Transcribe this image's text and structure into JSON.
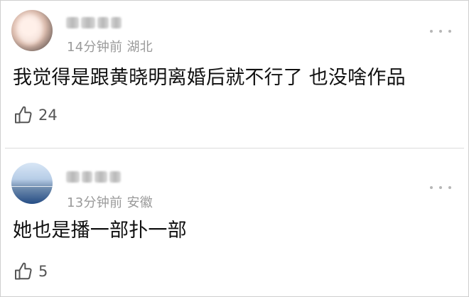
{
  "comments": [
    {
      "time": "14分钟前",
      "location": "湖北",
      "text": "我觉得是跟黄晓明离婚后就不行了 也没啥作品",
      "likes": "24"
    },
    {
      "time": "13分钟前",
      "location": "安徽",
      "text": "她也是播一部扑一部",
      "likes": "5"
    }
  ],
  "icons": {
    "like": "thumb-up-icon",
    "more": "more-options-icon"
  },
  "colors": {
    "meta": "#9a9a9a",
    "text": "#111111",
    "divider": "#dcdcdc"
  }
}
